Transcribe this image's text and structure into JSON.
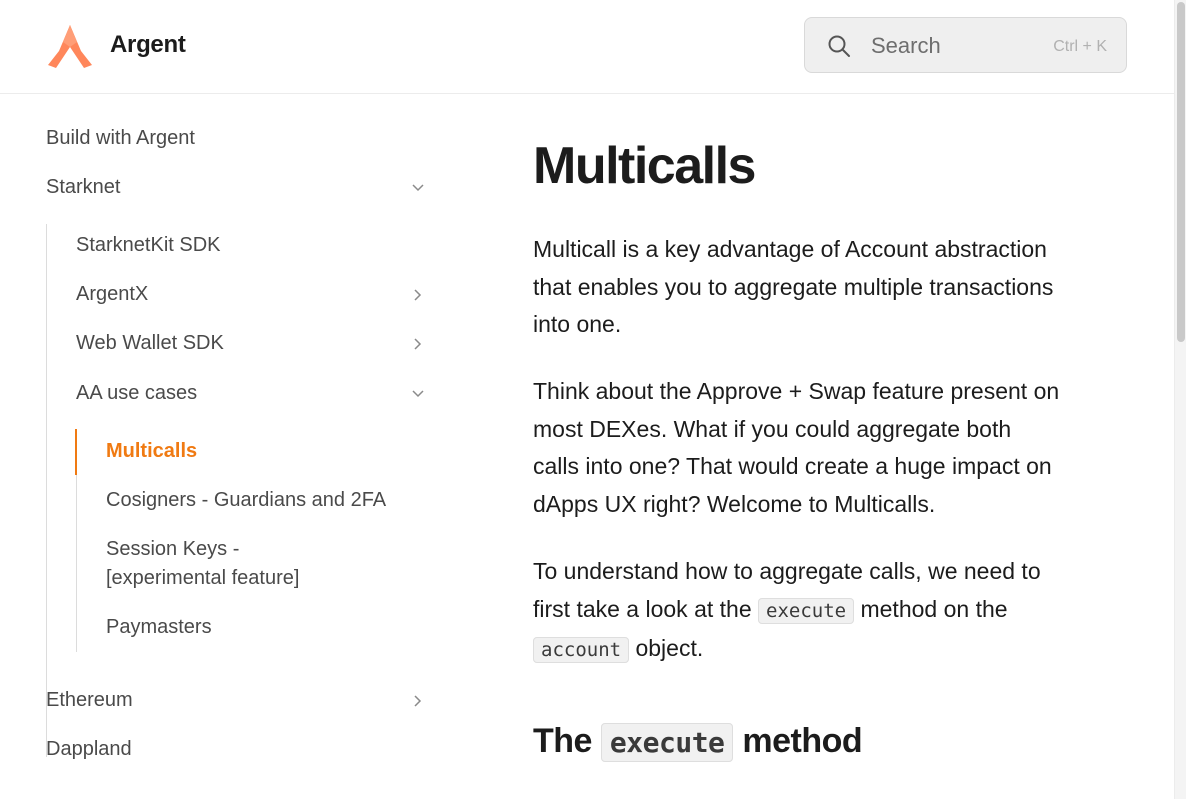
{
  "header": {
    "brand": "Argent",
    "search_placeholder": "Search",
    "search_shortcut": "Ctrl + K",
    "accent_color": "#f07a12",
    "logo_icon": "argent-logo-icon",
    "search_icon": "search-icon"
  },
  "sidebar": {
    "items": [
      {
        "label": "Build with Argent"
      },
      {
        "label": "Starknet",
        "expanded": true
      },
      {
        "label": "StarknetKit SDK"
      },
      {
        "label": "ArgentX",
        "expanded": false
      },
      {
        "label": "Web Wallet SDK",
        "expanded": false
      },
      {
        "label": "AA use cases",
        "expanded": true
      },
      {
        "label": "Multicalls",
        "active": true
      },
      {
        "label": "Cosigners - Guardians and 2FA"
      },
      {
        "label_line1": "Session Keys -",
        "label_line2": "[experimental feature]"
      },
      {
        "label": "Paymasters"
      },
      {
        "label": "Ethereum",
        "expanded": false
      },
      {
        "label": "Dappland"
      }
    ]
  },
  "main": {
    "title": "Multicalls",
    "p1": "Multicall is a key advantage of Account abstraction that enables you to aggregate multiple transactions into one.",
    "p2": "Think about the Approve + Swap feature present on most DEXes. What if you could aggregate both calls into one? That would create a huge impact on dApps UX right? Welcome to Multicalls.",
    "p3_part1": "To understand how to aggregate calls, we need to first take a look at the ",
    "p3_code1": "execute",
    "p3_part2": " method on the ",
    "p3_code2": "account",
    "p3_part3": " object.",
    "h2_part1": "The ",
    "h2_code": "execute",
    "h2_part2": " method"
  }
}
